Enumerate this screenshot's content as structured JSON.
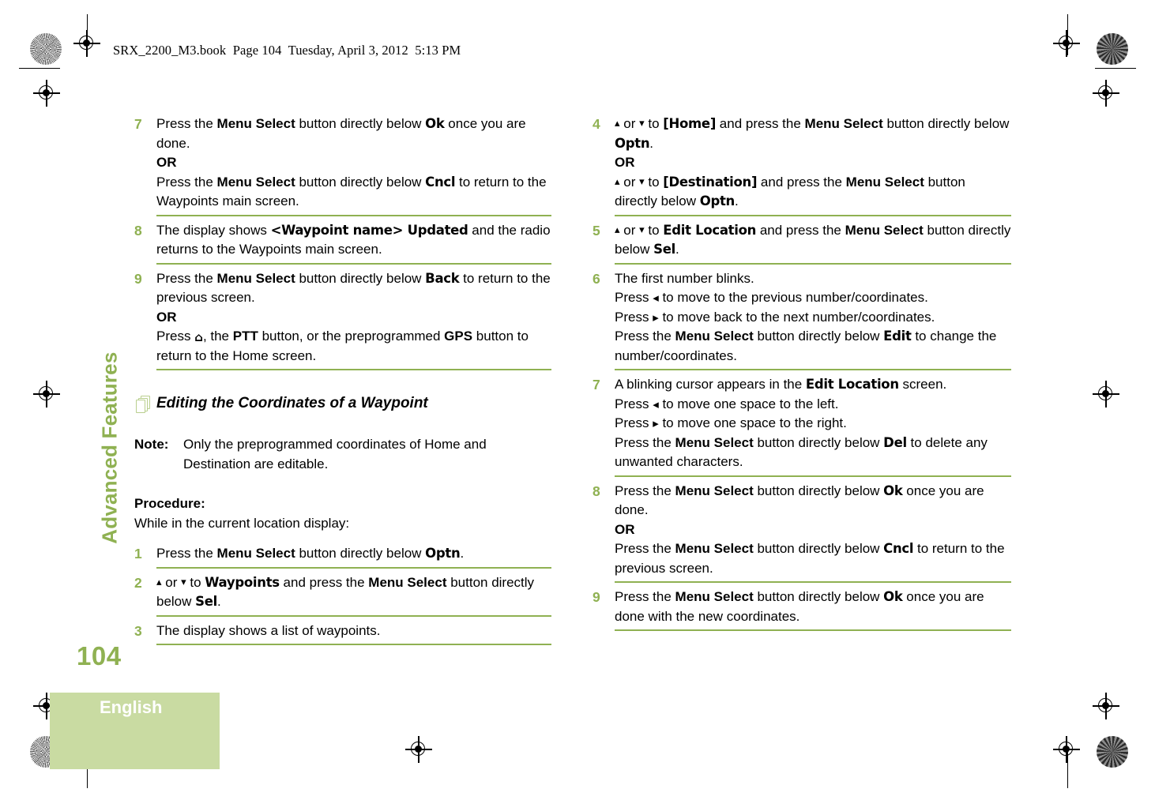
{
  "header": {
    "running_text": "SRX_2200_M3.book  Page 104  Tuesday, April 3, 2012  5:13 PM"
  },
  "sidebar": {
    "section_label": "Advanced Features",
    "page_number": "104",
    "language": "English"
  },
  "colors": {
    "accent_green": "#8fb152",
    "rule_green": "#8fb152",
    "band_green": "#c9dba2",
    "icon_green": "#b9cf8e"
  },
  "icons": {
    "up_arrow": "▴",
    "down_arrow": "▾",
    "left_arrow": "◂",
    "right_arrow": "▸",
    "home": "⌂"
  },
  "left_column": {
    "steps_top": [
      {
        "num": "7",
        "lines": [
          {
            "parts": [
              {
                "t": "Press the ",
                "s": "n"
              },
              {
                "t": "Menu Select",
                "s": "b"
              },
              {
                "t": " button directly below ",
                "s": "n"
              },
              {
                "t": "Ok",
                "s": "scr"
              },
              {
                "t": " once you are done.",
                "s": "n"
              }
            ]
          },
          {
            "parts": [
              {
                "t": "OR",
                "s": "b"
              }
            ]
          },
          {
            "parts": [
              {
                "t": "Press the ",
                "s": "n"
              },
              {
                "t": "Menu Select",
                "s": "b"
              },
              {
                "t": " button directly below ",
                "s": "n"
              },
              {
                "t": "Cncl",
                "s": "scr"
              },
              {
                "t": " to return to the Waypoints main screen.",
                "s": "n"
              }
            ]
          }
        ]
      },
      {
        "num": "8",
        "lines": [
          {
            "parts": [
              {
                "t": "The display shows ",
                "s": "n"
              },
              {
                "t": "<Waypoint name> Updated",
                "s": "scr"
              },
              {
                "t": " and the radio returns to the Waypoints main screen.",
                "s": "n"
              }
            ]
          }
        ]
      },
      {
        "num": "9",
        "lines": [
          {
            "parts": [
              {
                "t": "Press the ",
                "s": "n"
              },
              {
                "t": "Menu Select",
                "s": "b"
              },
              {
                "t": " button directly below ",
                "s": "n"
              },
              {
                "t": "Back",
                "s": "scr"
              },
              {
                "t": " to return to the previous screen.",
                "s": "n"
              }
            ]
          },
          {
            "parts": [
              {
                "t": "OR",
                "s": "b"
              }
            ]
          },
          {
            "parts": [
              {
                "t": "Press ",
                "s": "n"
              },
              {
                "t": "⌂",
                "s": "home"
              },
              {
                "t": ", the ",
                "s": "n"
              },
              {
                "t": "PTT",
                "s": "b"
              },
              {
                "t": " button, or the preprogrammed ",
                "s": "n"
              },
              {
                "t": "GPS",
                "s": "b"
              },
              {
                "t": " button to return to the Home screen.",
                "s": "n"
              }
            ]
          }
        ]
      }
    ],
    "section_heading": "Editing the Coordinates of a Waypoint",
    "note": {
      "label": "Note:",
      "text": "Only the preprogrammed coordinates of Home and Destination are editable."
    },
    "procedure_label": "Procedure:",
    "procedure_intro": "While in the current location display:",
    "steps_bottom": [
      {
        "num": "1",
        "lines": [
          {
            "parts": [
              {
                "t": "Press the ",
                "s": "n"
              },
              {
                "t": "Menu Select",
                "s": "b"
              },
              {
                "t": " button directly below ",
                "s": "n"
              },
              {
                "t": "Optn",
                "s": "scr"
              },
              {
                "t": ".",
                "s": "n"
              }
            ]
          }
        ]
      },
      {
        "num": "2",
        "lines": [
          {
            "parts": [
              {
                "t": "▴",
                "s": "ar"
              },
              {
                "t": " or ",
                "s": "n"
              },
              {
                "t": "▾",
                "s": "ar"
              },
              {
                "t": " to ",
                "s": "n"
              },
              {
                "t": "Waypoints",
                "s": "scr"
              },
              {
                "t": " and press the ",
                "s": "n"
              },
              {
                "t": "Menu Select",
                "s": "b"
              },
              {
                "t": " button directly below ",
                "s": "n"
              },
              {
                "t": "Sel",
                "s": "scr"
              },
              {
                "t": ".",
                "s": "n"
              }
            ]
          }
        ]
      },
      {
        "num": "3",
        "lines": [
          {
            "parts": [
              {
                "t": "The display shows a list of waypoints.",
                "s": "n"
              }
            ]
          }
        ]
      }
    ]
  },
  "right_column": {
    "steps": [
      {
        "num": "4",
        "lines": [
          {
            "parts": [
              {
                "t": "▴",
                "s": "ar"
              },
              {
                "t": " or ",
                "s": "n"
              },
              {
                "t": "▾",
                "s": "ar"
              },
              {
                "t": " to ",
                "s": "n"
              },
              {
                "t": "[Home]",
                "s": "scr"
              },
              {
                "t": " and press the ",
                "s": "n"
              },
              {
                "t": "Menu Select",
                "s": "b"
              },
              {
                "t": " button directly below ",
                "s": "n"
              },
              {
                "t": "Optn",
                "s": "scr"
              },
              {
                "t": ".",
                "s": "n"
              }
            ]
          },
          {
            "parts": [
              {
                "t": "OR",
                "s": "b"
              }
            ]
          },
          {
            "parts": [
              {
                "t": "▴",
                "s": "ar"
              },
              {
                "t": " or ",
                "s": "n"
              },
              {
                "t": "▾",
                "s": "ar"
              },
              {
                "t": " to ",
                "s": "n"
              },
              {
                "t": "[Destination]",
                "s": "scr"
              },
              {
                "t": " and press the ",
                "s": "n"
              },
              {
                "t": "Menu Select",
                "s": "b"
              },
              {
                "t": " button directly below ",
                "s": "n"
              },
              {
                "t": "Optn",
                "s": "scr"
              },
              {
                "t": ".",
                "s": "n"
              }
            ]
          }
        ]
      },
      {
        "num": "5",
        "lines": [
          {
            "parts": [
              {
                "t": "▴",
                "s": "ar"
              },
              {
                "t": " or ",
                "s": "n"
              },
              {
                "t": "▾",
                "s": "ar"
              },
              {
                "t": " to ",
                "s": "n"
              },
              {
                "t": "Edit Location",
                "s": "scr"
              },
              {
                "t": " and press the ",
                "s": "n"
              },
              {
                "t": "Menu Select",
                "s": "b"
              },
              {
                "t": " button directly below ",
                "s": "n"
              },
              {
                "t": "Sel",
                "s": "scr"
              },
              {
                "t": ".",
                "s": "n"
              }
            ]
          }
        ]
      },
      {
        "num": "6",
        "lines": [
          {
            "parts": [
              {
                "t": "The first number blinks.",
                "s": "n"
              }
            ]
          },
          {
            "parts": [
              {
                "t": "Press ",
                "s": "n"
              },
              {
                "t": "◂",
                "s": "arlr"
              },
              {
                "t": " to move to the previous number/coordinates.",
                "s": "n"
              }
            ]
          },
          {
            "parts": [
              {
                "t": "Press ",
                "s": "n"
              },
              {
                "t": "▸",
                "s": "arlr"
              },
              {
                "t": " to move back to the next number/coordinates.",
                "s": "n"
              }
            ]
          },
          {
            "parts": [
              {
                "t": "Press the ",
                "s": "n"
              },
              {
                "t": "Menu Select",
                "s": "b"
              },
              {
                "t": " button directly below ",
                "s": "n"
              },
              {
                "t": "Edit",
                "s": "scr"
              },
              {
                "t": " to change the number/coordinates.",
                "s": "n"
              }
            ]
          }
        ]
      },
      {
        "num": "7",
        "lines": [
          {
            "parts": [
              {
                "t": "A blinking cursor appears in the ",
                "s": "n"
              },
              {
                "t": "Edit Location",
                "s": "scr"
              },
              {
                "t": " screen.",
                "s": "n"
              }
            ]
          },
          {
            "parts": [
              {
                "t": "Press ",
                "s": "n"
              },
              {
                "t": "◂",
                "s": "arlr"
              },
              {
                "t": " to move one space to the left.",
                "s": "n"
              }
            ]
          },
          {
            "parts": [
              {
                "t": "Press ",
                "s": "n"
              },
              {
                "t": "▸",
                "s": "arlr"
              },
              {
                "t": " to move one space to the right.",
                "s": "n"
              }
            ]
          },
          {
            "parts": [
              {
                "t": "Press the ",
                "s": "n"
              },
              {
                "t": "Menu Select",
                "s": "b"
              },
              {
                "t": " button directly below ",
                "s": "n"
              },
              {
                "t": "Del",
                "s": "scr"
              },
              {
                "t": " to delete any unwanted characters.",
                "s": "n"
              }
            ]
          }
        ]
      },
      {
        "num": "8",
        "lines": [
          {
            "parts": [
              {
                "t": "Press the ",
                "s": "n"
              },
              {
                "t": "Menu Select",
                "s": "b"
              },
              {
                "t": " button directly below ",
                "s": "n"
              },
              {
                "t": "Ok",
                "s": "scr"
              },
              {
                "t": " once you are done.",
                "s": "n"
              }
            ]
          },
          {
            "parts": [
              {
                "t": "OR",
                "s": "b"
              }
            ]
          },
          {
            "parts": [
              {
                "t": "Press the ",
                "s": "n"
              },
              {
                "t": "Menu Select",
                "s": "b"
              },
              {
                "t": " button directly below ",
                "s": "n"
              },
              {
                "t": "Cncl",
                "s": "scr"
              },
              {
                "t": " to return to the previous screen.",
                "s": "n"
              }
            ]
          }
        ]
      },
      {
        "num": "9",
        "lines": [
          {
            "parts": [
              {
                "t": "Press the ",
                "s": "n"
              },
              {
                "t": "Menu Select",
                "s": "b"
              },
              {
                "t": " button directly below ",
                "s": "n"
              },
              {
                "t": "Ok",
                "s": "scr"
              },
              {
                "t": " once you are done with the new coordinates.",
                "s": "n"
              }
            ]
          }
        ]
      }
    ]
  }
}
